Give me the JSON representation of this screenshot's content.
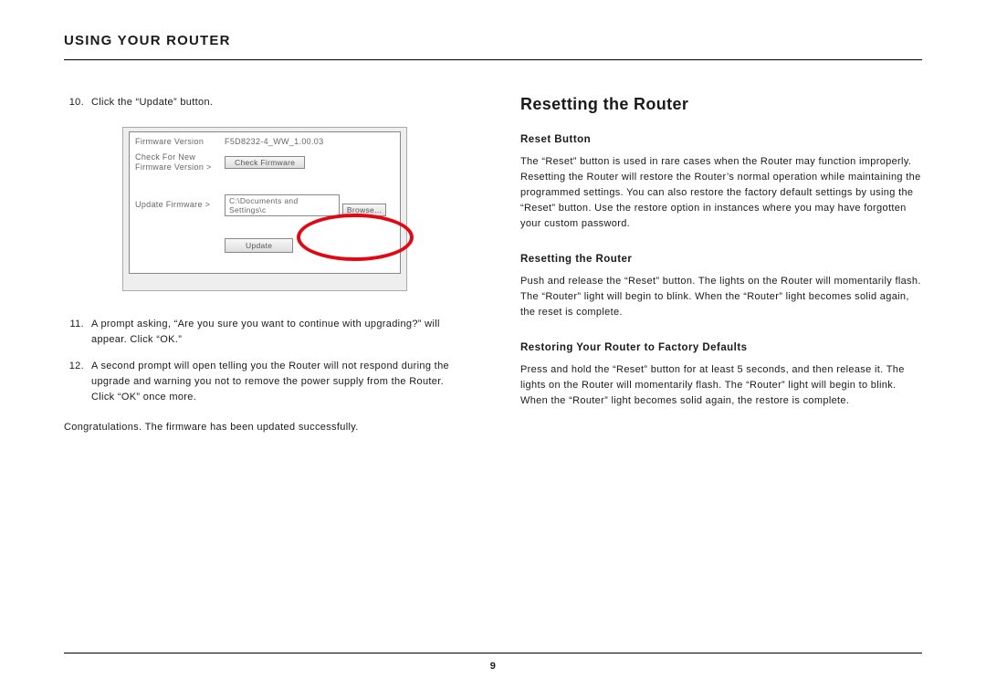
{
  "header": "USING YOUR ROUTER",
  "page_number": "9",
  "left": {
    "steps": [
      {
        "n": "10.",
        "t": "Click the “Update” button."
      },
      {
        "n": "11.",
        "t": "A prompt asking, “Are you sure you want to continue with upgrading?” will appear. Click “OK.”"
      },
      {
        "n": "12.",
        "t": "A second prompt will open telling you the Router will not respond during the upgrade and warning you not to remove the power supply from the Router. Click “OK” once more."
      }
    ],
    "congrats": "Congratulations. The firmware has been updated successfully.",
    "shot": {
      "fw_label": "Firmware Version",
      "fw_value": "F5D8232-4_WW_1.00.03",
      "check_label": "Check For New Firmware Version >",
      "check_btn": "Check Firmware",
      "update_label": "Update Firmware >",
      "update_path": "C:\\Documents and Settings\\c",
      "browse_btn": "Browse...",
      "update_btn": "Update"
    }
  },
  "right": {
    "title": "Resetting the Router",
    "s1_h": "Reset Button",
    "s1_p": "The “Reset” button is used in rare cases when the Router may function improperly. Resetting the Router will restore the Router’s normal operation while maintaining the programmed settings. You can also restore the factory default settings by using the “Reset” button. Use the restore option in instances where you may have forgotten your custom password.",
    "s2_h": "Resetting the Router",
    "s2_p": "Push and release the “Reset” button. The lights on the Router will momentarily flash. The “Router” light will begin to blink. When the “Router” light becomes solid again, the reset is complete.",
    "s3_h": "Restoring Your Router to Factory Defaults",
    "s3_p": "Press and hold the “Reset” button for at least 5 seconds, and then release it. The lights on the Router will momentarily flash. The “Router” light will begin to blink. When the “Router” light becomes solid again, the restore is complete."
  }
}
